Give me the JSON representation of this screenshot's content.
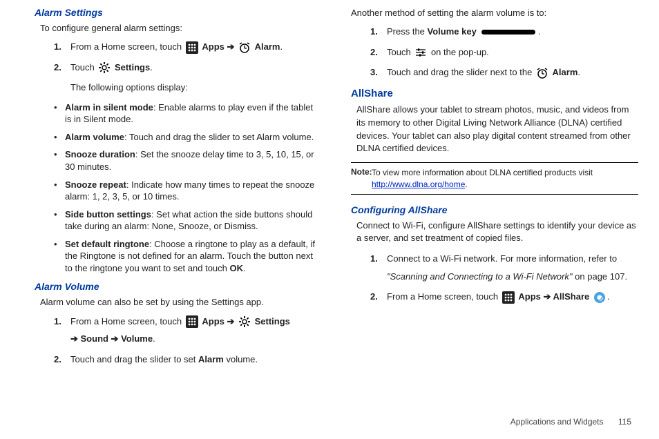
{
  "left": {
    "alarm_settings_h": "Alarm Settings",
    "alarm_settings_intro": "To configure general alarm settings:",
    "step1_a": "From a Home screen, touch ",
    "apps": "Apps",
    "arrow": " ➔ ",
    "alarm": "Alarm",
    "step2_a": "Touch ",
    "settings": "Settings",
    "step2_b": "The following options display:",
    "bullets": [
      {
        "t": "Alarm in silent mode",
        "d": ": Enable alarms to play even if the tablet is in Silent mode."
      },
      {
        "t": "Alarm volume",
        "d": ": Touch and drag the slider to set Alarm volume."
      },
      {
        "t": "Snooze duration",
        "d": ": Set the snooze delay time to 3, 5, 10, 15, or 30 minutes."
      },
      {
        "t": "Snooze repeat",
        "d": ": Indicate how many times to repeat the snooze alarm: 1, 2, 3, 5, or 10 times."
      },
      {
        "t": "Side button settings",
        "d": ": Set what action the side buttons should take during an alarm: None, Snooze, or Dismiss."
      },
      {
        "t": "Set default ringtone",
        "d": ": Choose a ringtone to play as a default, if the Ringtone is not defined for an alarm. Touch the button next to the ringtone you want to set and touch "
      }
    ],
    "ok": "OK",
    "alarm_volume_h": "Alarm Volume",
    "alarm_volume_intro": "Alarm volume can also be set by using the Settings app.",
    "av_step1_a": "From a Home screen, touch ",
    "sound_volume": " Sound ➔ Volume",
    "av_step2": "Touch and drag the slider to set ",
    "alarm_word": "Alarm",
    "volume_suffix": " volume."
  },
  "right": {
    "another_intro": "Another method of setting the alarm volume is to:",
    "r1_a": "Press the ",
    "volkey": "Volume key",
    "r2_a": "Touch ",
    "r2_b": " on the pop-up.",
    "r3_a": "Touch and drag the slider next to the ",
    "alarm": "Alarm",
    "allshare_h": "AllShare",
    "allshare_body": "AllShare allows your tablet to stream photos, music, and videos from its memory to other Digital Living Network Alliance (DLNA) certified devices. Your tablet can also play digital content streamed from other DLNA certified devices.",
    "note_label": "Note:",
    "note_text": "To view more information about DLNA certified products visit ",
    "note_link": "http://www.dlna.org/home",
    "cfg_h": "Configuring AllShare",
    "cfg_intro": "Connect to Wi-Fi, configure AllShare settings to identify your device as a server, and set treatment of copied files.",
    "c1_a": "Connect to a Wi-Fi network. For more information, refer to ",
    "c1_ref": "\"Scanning and Connecting to a Wi-Fi Network\"",
    "c1_b": " on page 107.",
    "c2_a": "From a Home screen, touch ",
    "apps": "Apps",
    "arrow": " ➔ ",
    "allshare": "AllShare"
  },
  "footer": {
    "section": "Applications and Widgets",
    "page": "115"
  }
}
